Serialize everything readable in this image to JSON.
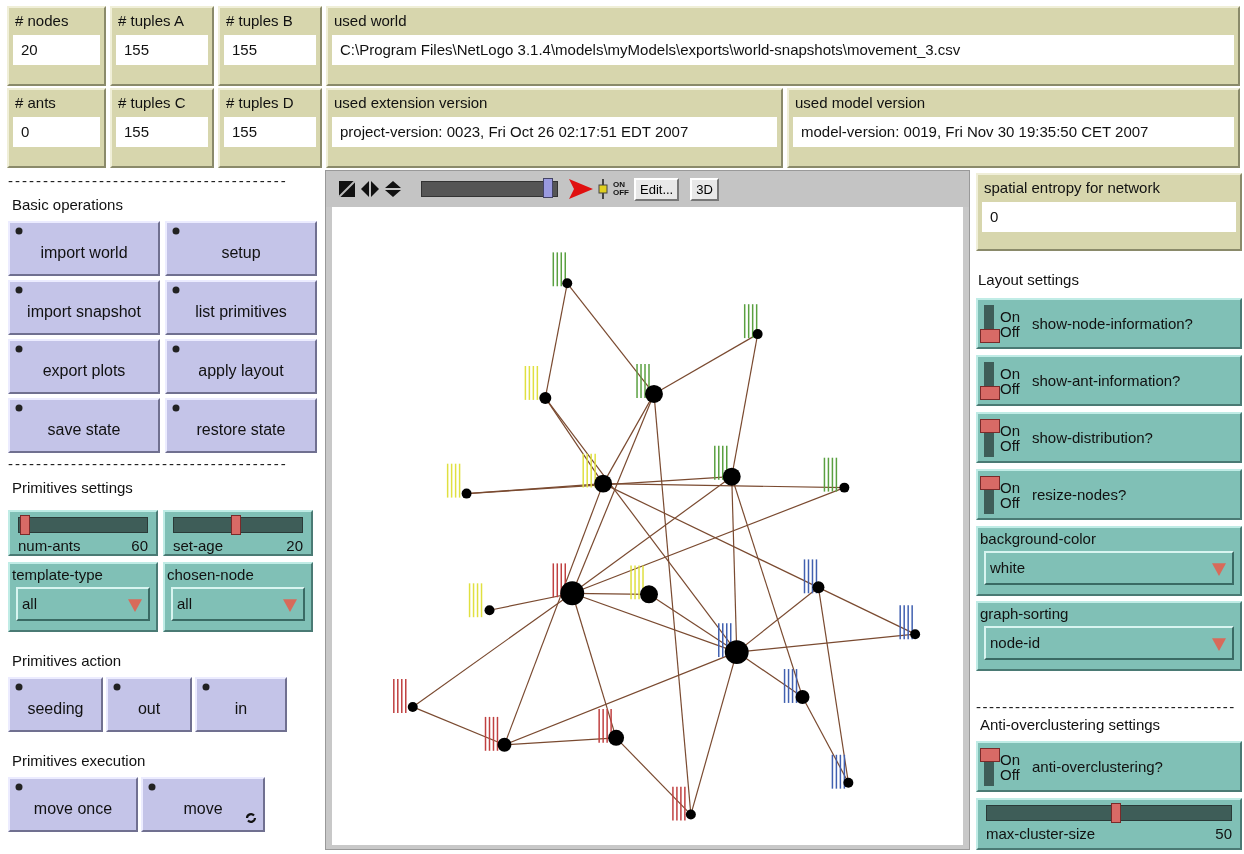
{
  "monitors": [
    [
      {
        "label": "# nodes",
        "value": "20"
      },
      {
        "label": "# tuples A",
        "value": "155"
      },
      {
        "label": "# tuples B",
        "value": "155"
      },
      {
        "label": "used world",
        "value": "C:\\Program Files\\NetLogo 3.1.4\\models\\myModels\\exports\\world-snapshots\\movement_3.csv"
      }
    ],
    [
      {
        "label": "# ants",
        "value": "0"
      },
      {
        "label": "# tuples C",
        "value": "155"
      },
      {
        "label": "# tuples D",
        "value": "155"
      },
      {
        "label": "used extension version",
        "value": "project-version: 0023, Fri Oct 26 02:17:51 EDT 2007"
      },
      {
        "label": "used model version",
        "value": "model-version: 0019, Fri Nov 30 19:35:50 CET 2007"
      }
    ]
  ],
  "basic_operations": {
    "divider": "----------------------------------------",
    "heading": "Basic operations",
    "buttons": [
      {
        "label": "import world",
        "forever": false
      },
      {
        "label": "setup",
        "forever": false
      },
      {
        "label": "import snapshot",
        "forever": false
      },
      {
        "label": "list primitives",
        "forever": false
      },
      {
        "label": "export plots",
        "forever": false
      },
      {
        "label": "apply layout",
        "forever": false
      },
      {
        "label": "save state",
        "forever": false
      },
      {
        "label": "restore state",
        "forever": false
      }
    ]
  },
  "primitives_settings": {
    "divider": "----------------------------------------",
    "heading": "Primitives settings",
    "sliders": [
      {
        "label": "num-ants",
        "value": "60",
        "level": 0.03
      },
      {
        "label": "set-age",
        "value": "20",
        "level": 0.47
      }
    ],
    "choosers": [
      {
        "label": "template-type",
        "value": "all"
      },
      {
        "label": "chosen-node",
        "value": "all"
      }
    ]
  },
  "primitives_action": {
    "heading": "Primitives action",
    "buttons": [
      {
        "label": "seeding",
        "forever": false
      },
      {
        "label": "out",
        "forever": false
      },
      {
        "label": "in",
        "forever": false
      }
    ]
  },
  "primitives_execution": {
    "heading": "Primitives execution",
    "buttons": [
      {
        "label": "move once",
        "forever": false
      },
      {
        "label": "move",
        "forever": true
      }
    ]
  },
  "view_toolbar": {
    "speed_slider": {
      "level": 0.97
    },
    "updates_on": "ON",
    "updates_off": "OFF",
    "edit": "Edit...",
    "three_d": "3D"
  },
  "entropy_monitor": {
    "label": "spatial entropy for network",
    "value": "0"
  },
  "layout_settings": {
    "heading": "Layout settings",
    "switches": [
      {
        "label": "show-node-information?",
        "on_text": "On",
        "off_text": "Off",
        "on": false
      },
      {
        "label": "show-ant-information?",
        "on_text": "On",
        "off_text": "Off",
        "on": false
      },
      {
        "label": "show-distribution?",
        "on_text": "On",
        "off_text": "Off",
        "on": true
      },
      {
        "label": "resize-nodes?",
        "on_text": "On",
        "off_text": "Off",
        "on": true
      }
    ],
    "choosers": [
      {
        "label": "background-color",
        "value": "white"
      },
      {
        "label": "graph-sorting",
        "value": "node-id"
      }
    ]
  },
  "anti_overclustering": {
    "divider": "----------------------------------------",
    "heading": "Anti-overclustering settings",
    "switch": {
      "label": "anti-overclustering?",
      "on_text": "On",
      "off_text": "Off",
      "on": true
    },
    "slider": {
      "label": "max-cluster-size",
      "value": "50",
      "level": 0.52
    }
  }
}
